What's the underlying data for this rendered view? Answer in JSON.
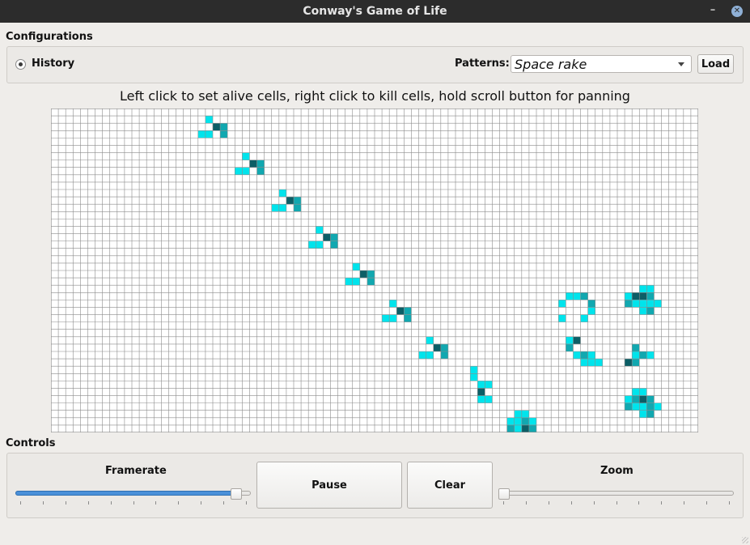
{
  "window": {
    "title": "Conway's Game of Life"
  },
  "configurations": {
    "group_title": "Configurations",
    "history_label": "History",
    "patterns_label": "Patterns:",
    "pattern_selected": "Space rake",
    "load_label": "Load"
  },
  "instructions": "Left click to set alive cells, right click to kill cells, hold scroll button for panning",
  "controls": {
    "group_title": "Controls",
    "framerate_label": "Framerate",
    "framerate_level": 0.96,
    "pause_label": "Pause",
    "clear_label": "Clear",
    "zoom_label": "Zoom",
    "zoom_level": 0.0
  },
  "colors": {
    "alive": "#00e4ec",
    "alive_mid": "#11a8b0",
    "alive_dark": "#0c5e66",
    "grid_line": "#8c8c8c",
    "grid_bg": "#ffffff",
    "accent": "#4a90d9"
  },
  "grid": {
    "cols": 88,
    "rows": 44,
    "cells": [
      [
        21,
        1,
        "a"
      ],
      [
        22,
        2,
        "d"
      ],
      [
        23,
        2,
        "m"
      ],
      [
        21,
        3,
        "a"
      ],
      [
        23,
        3,
        "m"
      ],
      [
        20,
        3,
        "a"
      ],
      [
        26,
        6,
        "a"
      ],
      [
        27,
        7,
        "d"
      ],
      [
        28,
        7,
        "m"
      ],
      [
        26,
        8,
        "a"
      ],
      [
        28,
        8,
        "m"
      ],
      [
        25,
        8,
        "a"
      ],
      [
        31,
        11,
        "a"
      ],
      [
        32,
        12,
        "d"
      ],
      [
        33,
        12,
        "m"
      ],
      [
        31,
        13,
        "a"
      ],
      [
        33,
        13,
        "m"
      ],
      [
        30,
        13,
        "a"
      ],
      [
        36,
        16,
        "a"
      ],
      [
        37,
        17,
        "d"
      ],
      [
        38,
        17,
        "m"
      ],
      [
        36,
        18,
        "a"
      ],
      [
        38,
        18,
        "m"
      ],
      [
        35,
        18,
        "a"
      ],
      [
        41,
        21,
        "a"
      ],
      [
        42,
        22,
        "d"
      ],
      [
        43,
        22,
        "m"
      ],
      [
        41,
        23,
        "a"
      ],
      [
        43,
        23,
        "m"
      ],
      [
        40,
        23,
        "a"
      ],
      [
        46,
        26,
        "a"
      ],
      [
        47,
        27,
        "d"
      ],
      [
        48,
        27,
        "m"
      ],
      [
        46,
        28,
        "a"
      ],
      [
        48,
        28,
        "m"
      ],
      [
        45,
        28,
        "a"
      ],
      [
        51,
        31,
        "a"
      ],
      [
        52,
        32,
        "d"
      ],
      [
        53,
        32,
        "m"
      ],
      [
        51,
        33,
        "a"
      ],
      [
        53,
        33,
        "m"
      ],
      [
        50,
        33,
        "a"
      ],
      [
        57,
        35,
        "a"
      ],
      [
        57,
        36,
        "a"
      ],
      [
        58,
        37,
        "a"
      ],
      [
        59,
        37,
        "a"
      ],
      [
        58,
        38,
        "d"
      ],
      [
        58,
        39,
        "a"
      ],
      [
        59,
        39,
        "a"
      ],
      [
        63,
        41,
        "a"
      ],
      [
        64,
        41,
        "a"
      ],
      [
        62,
        42,
        "a"
      ],
      [
        63,
        42,
        "a"
      ],
      [
        64,
        42,
        "m"
      ],
      [
        65,
        42,
        "a"
      ],
      [
        62,
        43,
        "m"
      ],
      [
        63,
        43,
        "a"
      ],
      [
        64,
        43,
        "d"
      ],
      [
        65,
        43,
        "m"
      ],
      [
        70,
        25,
        "a"
      ],
      [
        71,
        25,
        "a"
      ],
      [
        72,
        25,
        "m"
      ],
      [
        69,
        26,
        "a"
      ],
      [
        73,
        26,
        "m"
      ],
      [
        73,
        27,
        "a"
      ],
      [
        69,
        28,
        "a"
      ],
      [
        72,
        28,
        "a"
      ],
      [
        70,
        31,
        "a"
      ],
      [
        71,
        31,
        "d"
      ],
      [
        70,
        32,
        "m"
      ],
      [
        71,
        33,
        "a"
      ],
      [
        72,
        33,
        "m"
      ],
      [
        73,
        33,
        "a"
      ],
      [
        72,
        34,
        "a"
      ],
      [
        73,
        34,
        "a"
      ],
      [
        74,
        34,
        "a"
      ],
      [
        80,
        24,
        "a"
      ],
      [
        81,
        24,
        "a"
      ],
      [
        78,
        25,
        "a"
      ],
      [
        79,
        25,
        "d"
      ],
      [
        80,
        25,
        "d"
      ],
      [
        81,
        25,
        "m"
      ],
      [
        78,
        26,
        "m"
      ],
      [
        79,
        26,
        "a"
      ],
      [
        80,
        26,
        "a"
      ],
      [
        81,
        26,
        "a"
      ],
      [
        82,
        26,
        "a"
      ],
      [
        80,
        27,
        "a"
      ],
      [
        81,
        27,
        "m"
      ],
      [
        79,
        32,
        "m"
      ],
      [
        79,
        33,
        "a"
      ],
      [
        80,
        33,
        "m"
      ],
      [
        81,
        33,
        "a"
      ],
      [
        78,
        34,
        "d"
      ],
      [
        79,
        34,
        "m"
      ],
      [
        79,
        38,
        "a"
      ],
      [
        80,
        38,
        "a"
      ],
      [
        78,
        39,
        "a"
      ],
      [
        79,
        39,
        "m"
      ],
      [
        80,
        39,
        "d"
      ],
      [
        81,
        39,
        "m"
      ],
      [
        78,
        40,
        "m"
      ],
      [
        79,
        40,
        "a"
      ],
      [
        80,
        40,
        "a"
      ],
      [
        81,
        40,
        "m"
      ],
      [
        82,
        40,
        "a"
      ],
      [
        80,
        41,
        "a"
      ],
      [
        81,
        41,
        "m"
      ]
    ]
  }
}
